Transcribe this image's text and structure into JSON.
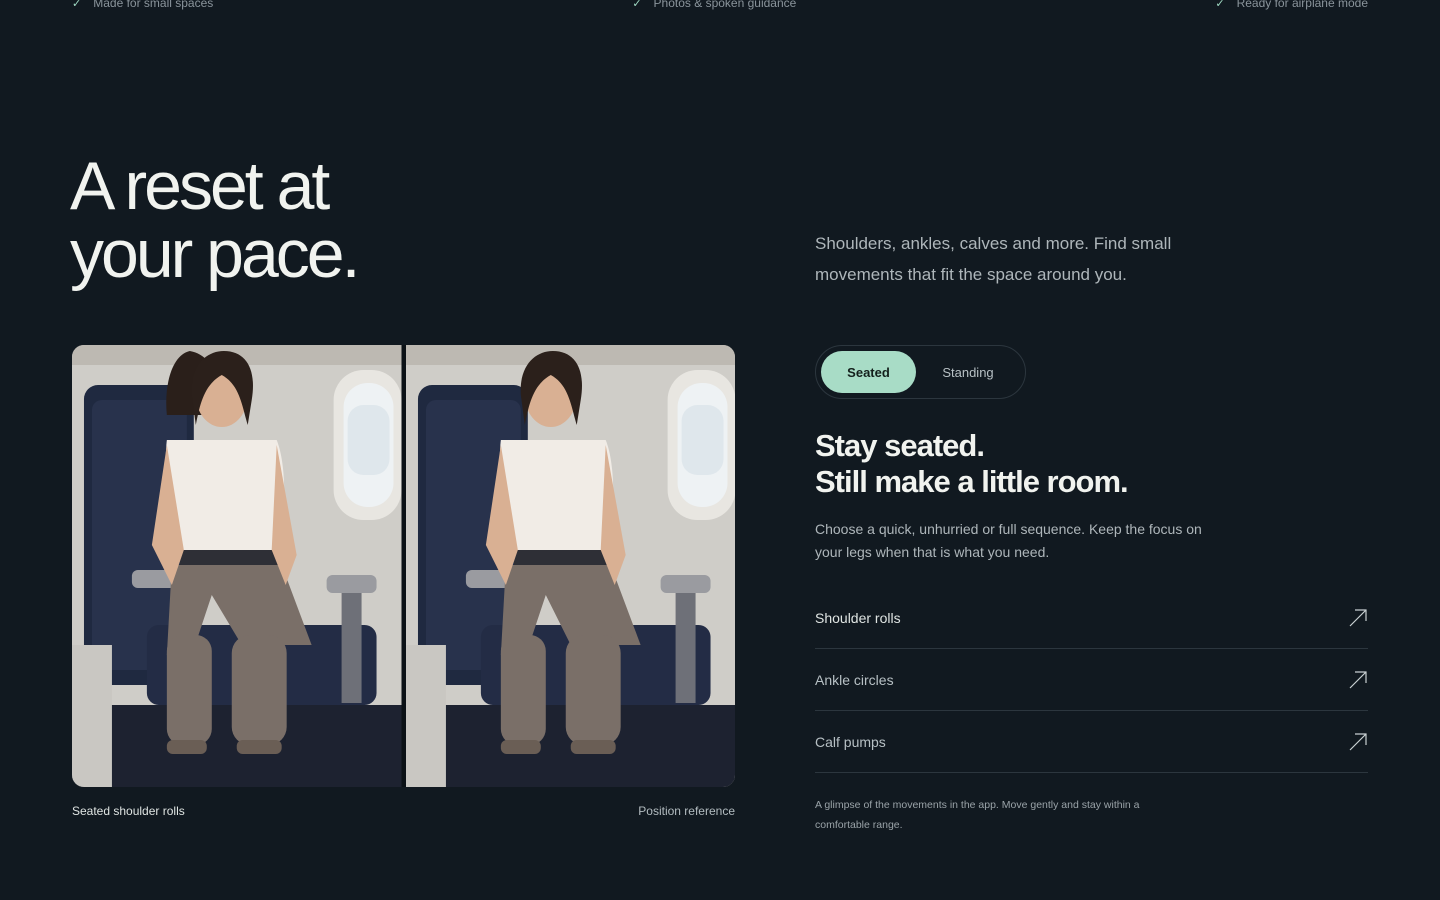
{
  "features": [
    {
      "check": "✓",
      "label": "Made for small spaces"
    },
    {
      "check": "✓",
      "label": "Photos & spoken guidance"
    },
    {
      "check": "✓",
      "label": "Ready for airplane mode"
    }
  ],
  "hero": {
    "title_line1": "A reset at",
    "title_line2": "your pace.",
    "intro": "Shoulders, ankles, calves and more. Find small movements that fit the space around you."
  },
  "photo": {
    "caption_left": "Seated shoulder rolls",
    "caption_right": "Position reference"
  },
  "toggle": {
    "options": [
      "Seated",
      "Standing"
    ],
    "selected": "Seated"
  },
  "section": {
    "title_line1": "Stay seated.",
    "title_line2": "Still make a little room.",
    "description": "Choose a quick, unhurried or full sequence. Keep the focus on your legs when that is what you need."
  },
  "movements": [
    {
      "label": "Shoulder rolls",
      "icon": "arrow-up-right-icon"
    },
    {
      "label": "Ankle circles",
      "icon": "arrow-up-right-icon"
    },
    {
      "label": "Calf pumps",
      "icon": "arrow-up-right-icon"
    }
  ],
  "footnote": "A glimpse of the movements in the app. Move gently and stay within a comfortable range.",
  "colors": {
    "background": "#111920",
    "accent": "#a8dcc6",
    "text": "#f1f3ef",
    "muted": "#aeb6ba"
  }
}
